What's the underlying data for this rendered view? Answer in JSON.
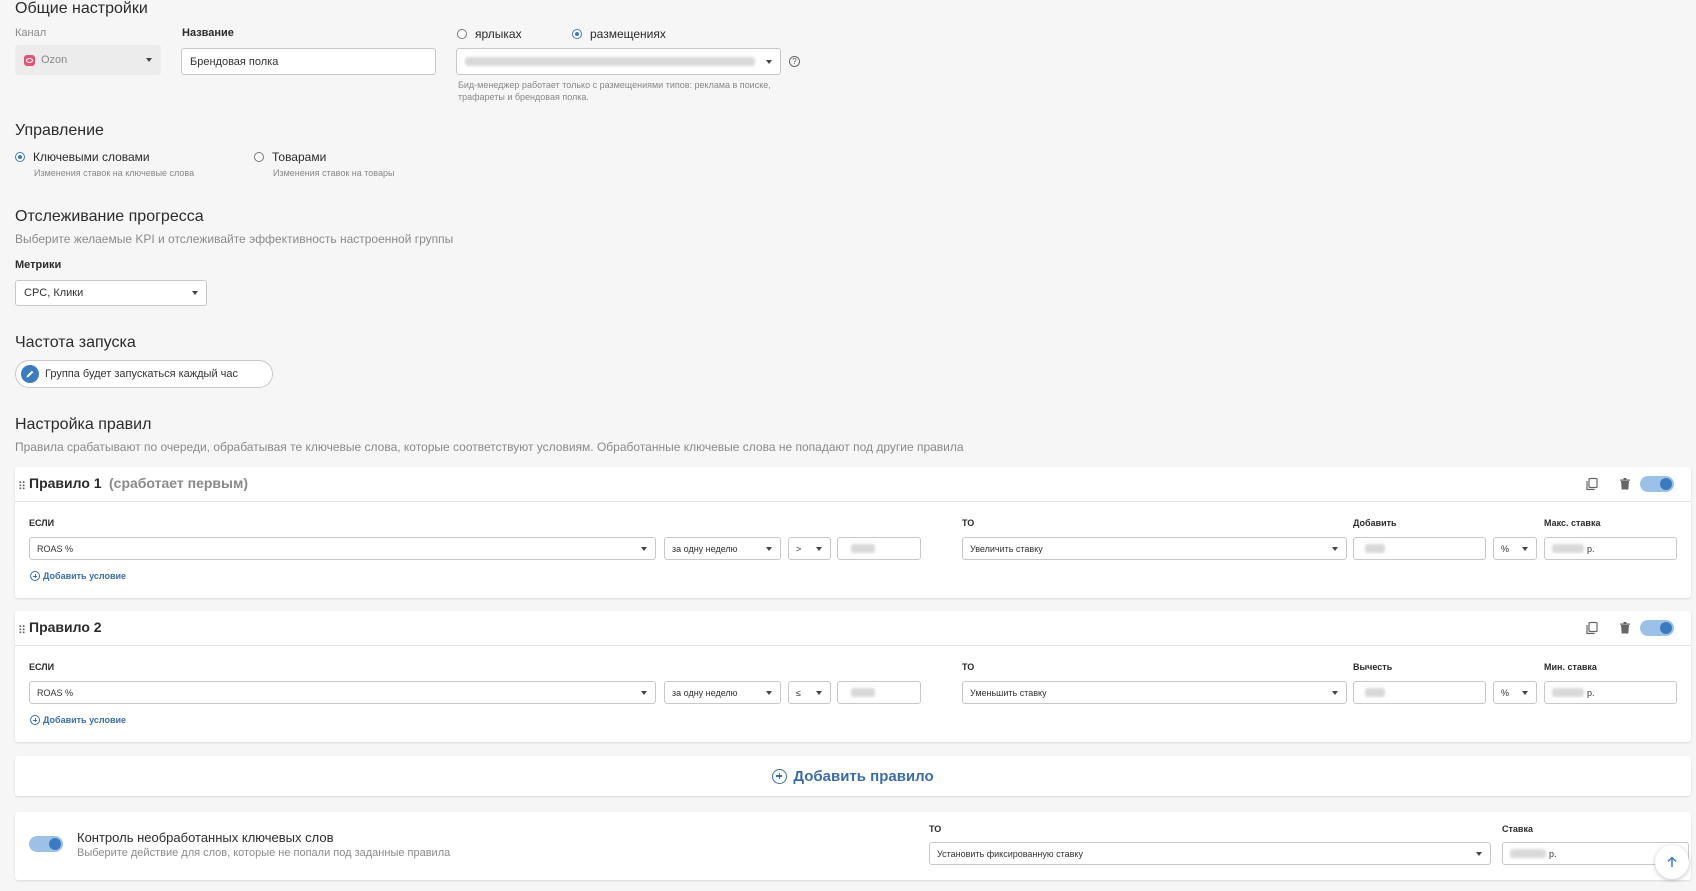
{
  "general": {
    "title": "Общие настройки",
    "channel_label": "Канал",
    "channel_value": "Ozon",
    "name_label": "Название",
    "name_value": "Брендовая полка",
    "radio_labels": "ярлыках",
    "radio_placements": "размещениях",
    "placement_hint": "Бид-менеджер работает только с размещениями типов: реклама в поиске, трафареты и брендовая полка."
  },
  "control": {
    "title": "Управление",
    "opt1_label": "Ключевыми словами",
    "opt1_hint": "Изменения ставок на ключевые слова",
    "opt2_label": "Товарами",
    "opt2_hint": "Изменения ставок на товары"
  },
  "progress": {
    "title": "Отслеживание прогресса",
    "subtitle": "Выберите желаемые KPI и отслеживайте эффективность настроенной группы",
    "metrics_label": "Метрики",
    "metrics_value": "CPC, Клики"
  },
  "frequency": {
    "title": "Частота запуска",
    "chip_text": "Группа будет запускаться каждый час"
  },
  "rules": {
    "title": "Настройка правил",
    "subtitle": "Правила срабатывают по очереди, обрабатывая те ключевые слова, которые соответствуют условиям. Обработанные ключевые слова не попадают под другие правила",
    "rule1": {
      "title": "Правило 1",
      "note": "(сработает первым)",
      "if_label": "ЕСЛИ",
      "metric": "ROAS %",
      "period": "за одну неделю",
      "operator": ">",
      "then_label": "ТО",
      "action": "Увеличить ставку",
      "amount_label": "Добавить",
      "unit": "%",
      "limit_label": "Макс. ставка",
      "currency": "р.",
      "add_condition": "Добавить условие"
    },
    "rule2": {
      "title": "Правило 2",
      "if_label": "ЕСЛИ",
      "metric": "ROAS %",
      "period": "за одну неделю",
      "operator": "≤",
      "then_label": "ТО",
      "action": "Уменьшить ставку",
      "amount_label": "Вычесть",
      "unit": "%",
      "limit_label": "Мин. ставка",
      "currency": "р.",
      "add_condition": "Добавить условие"
    },
    "add_rule": "Добавить правило"
  },
  "unprocessed": {
    "title": "Контроль необработанных ключевых слов",
    "subtitle": "Выберите действие для слов, которые не попали под заданные правила",
    "then_label": "ТО",
    "action": "Установить фиксированную ставку",
    "rate_label": "Ставка",
    "currency": "р."
  },
  "colors": {
    "accent": "#3b7bbf",
    "link": "#3b6ea8",
    "background": "#f6f6f6"
  }
}
